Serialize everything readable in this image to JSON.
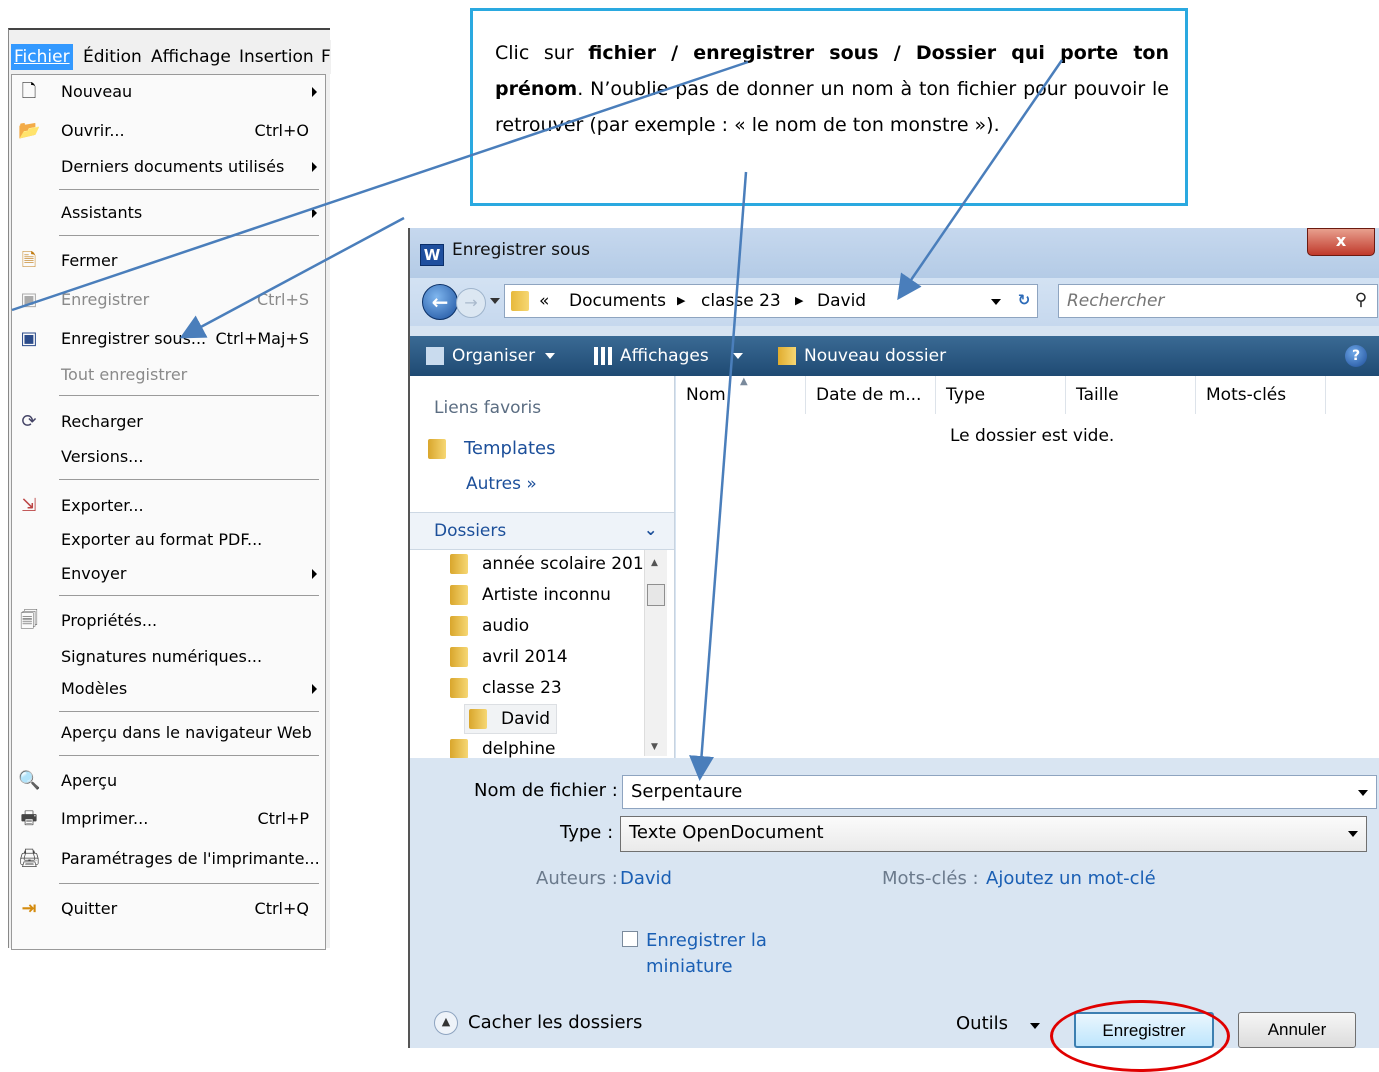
{
  "menubar": {
    "items": [
      "Fichier",
      "Édition",
      "Affichage",
      "Insertion",
      "F"
    ]
  },
  "menu": {
    "items": [
      {
        "icon": "blank-page-icon",
        "label": "Nouveau",
        "shortcut": "",
        "submenu": true
      },
      {
        "icon": "open-folder-icon",
        "label": "Ouvrir...",
        "shortcut": "Ctrl+O"
      },
      {
        "icon": "",
        "label": "Derniers documents utilisés",
        "shortcut": "",
        "submenu": true
      },
      {
        "icon": "",
        "label": "Assistants",
        "shortcut": "",
        "submenu": true
      },
      {
        "icon": "close-document-icon",
        "label": "Fermer",
        "shortcut": ""
      },
      {
        "icon": "save-icon",
        "label": "Enregistrer",
        "shortcut": "Ctrl+S",
        "disabled": true
      },
      {
        "icon": "save-as-icon",
        "label": "Enregistrer sous...",
        "shortcut": "Ctrl+Maj+S"
      },
      {
        "icon": "",
        "label": "Tout enregistrer",
        "shortcut": "",
        "disabled": true
      },
      {
        "icon": "reload-icon",
        "label": "Recharger",
        "shortcut": ""
      },
      {
        "icon": "",
        "label": "Versions...",
        "shortcut": ""
      },
      {
        "icon": "export-icon",
        "label": "Exporter...",
        "shortcut": ""
      },
      {
        "icon": "",
        "label": "Exporter au format PDF...",
        "shortcut": ""
      },
      {
        "icon": "",
        "label": "Envoyer",
        "shortcut": "",
        "submenu": true
      },
      {
        "icon": "properties-icon",
        "label": "Propriétés...",
        "shortcut": ""
      },
      {
        "icon": "",
        "label": "Signatures numériques...",
        "shortcut": ""
      },
      {
        "icon": "",
        "label": "Modèles",
        "shortcut": "",
        "submenu": true
      },
      {
        "icon": "",
        "label": "Aperçu dans le navigateur Web",
        "shortcut": ""
      },
      {
        "icon": "preview-icon",
        "label": "Aperçu",
        "shortcut": ""
      },
      {
        "icon": "printer-icon",
        "label": "Imprimer...",
        "shortcut": "Ctrl+P"
      },
      {
        "icon": "printer-settings-icon",
        "label": "Paramétrages de l'imprimante...",
        "shortcut": ""
      },
      {
        "icon": "quit-icon",
        "label": "Quitter",
        "shortcut": "Ctrl+Q"
      }
    ]
  },
  "callout": {
    "t1": "Clic sur ",
    "b1": "fichier / enregistrer sous / Dossier qui porte ton prénom",
    "t2": ". N’oublie pas de donner un nom à ton fichier pour pouvoir le retrouver (par exemple : « le nom de ton monstre »)."
  },
  "dialog": {
    "title": "Enregistrer sous",
    "app_letter": "W",
    "close_label": "x",
    "breadcrumb": [
      "«",
      "Documents",
      "classe 23",
      "David"
    ],
    "search_placeholder": "Rechercher",
    "toolbar": {
      "organize": "Organiser",
      "views": "Affichages",
      "new_folder": "Nouveau dossier"
    },
    "fav_header": "Liens favoris",
    "favorites": [
      "Templates",
      "Autres »"
    ],
    "folders_header": "Dossiers",
    "folders": [
      "année scolaire 201(",
      "Artiste inconnu",
      "audio",
      "avril 2014",
      "classe 23",
      "David",
      "delphine"
    ],
    "columns": [
      "Nom",
      "Date de m...",
      "Type",
      "Taille",
      "Mots-clés"
    ],
    "empty_message": "Le dossier est vide.",
    "filename_label": "Nom de fichier :",
    "filename_value": "Serpentaure",
    "type_label": "Type :",
    "type_value": "Texte OpenDocument",
    "authors_label": "Auteurs :",
    "authors_value": "David",
    "tags_label": "Mots-clés :",
    "tags_value": "Ajoutez un mot-clé",
    "thumbnail_label": "Enregistrer la miniature",
    "hide_folders": "Cacher les dossiers",
    "tools": "Outils",
    "save_button": "Enregistrer",
    "cancel_button": "Annuler"
  },
  "colors": {
    "annotation_arrow": "#4a7ebb",
    "callout_border": "#2aa9e0",
    "highlight_circle": "#e00000"
  }
}
